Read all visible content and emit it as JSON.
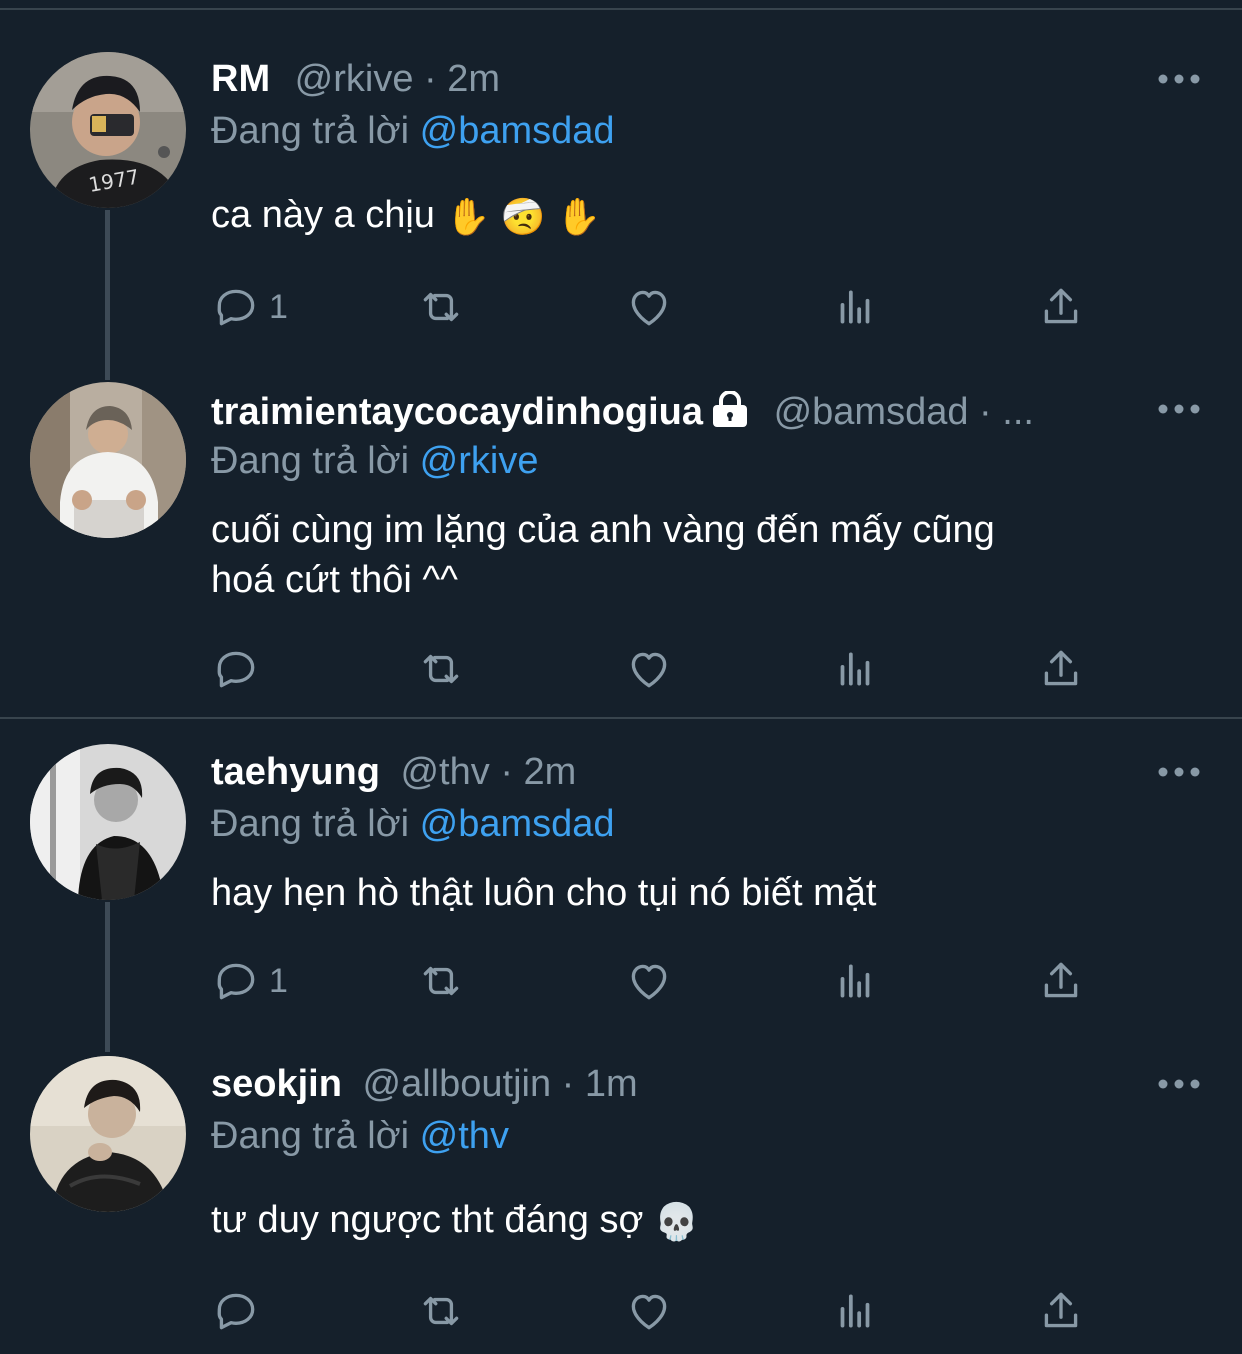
{
  "tweets": [
    {
      "name": "RM",
      "handle": "@rkive",
      "dot": "·",
      "time": "2m",
      "reply_prefix": "Đang trả lời ",
      "reply_to": "@bamsdad",
      "text": "ca này a chịu",
      "emojis": [
        "✋",
        "🤕",
        "✋"
      ],
      "reply_count": "1"
    },
    {
      "name": "traimientaycocaydinhogiua",
      "handle": "@bamsdad",
      "dot": "·",
      "time": "...",
      "reply_prefix": "Đang trả lời ",
      "reply_to": "@rkive",
      "text_line1": "cuối cùng im lặng của anh vàng đến mấy cũng",
      "text_line2": "hoá cứt thôi ^^",
      "reply_count": ""
    },
    {
      "name": "taehyung",
      "handle": "@thv",
      "dot": "·",
      "time": "2m",
      "reply_prefix": "Đang trả lời ",
      "reply_to": "@bamsdad",
      "text": "hay hẹn hò thật luôn cho tụi nó biết mặt",
      "reply_count": "1"
    },
    {
      "name": "seokjin",
      "handle": "@allboutjin",
      "dot": "·",
      "time": "1m",
      "reply_prefix": "Đang trả lời ",
      "reply_to": "@thv",
      "text": "tư duy ngược tht đáng sợ",
      "emojis": [
        "💀"
      ],
      "reply_count": ""
    }
  ],
  "icons": {
    "reply": "reply-icon",
    "retweet": "retweet-icon",
    "like": "like-icon",
    "analytics": "analytics-icon",
    "share": "share-icon",
    "more": "more-icon",
    "lock": "lock-icon"
  },
  "colors": {
    "background": "#15202b",
    "secondary_text": "#8899a6",
    "mention": "#3ea1f0",
    "divider": "#38444d"
  }
}
